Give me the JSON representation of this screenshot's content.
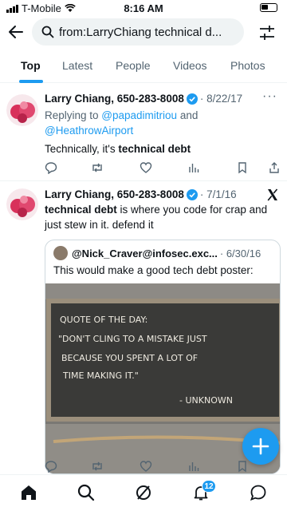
{
  "status": {
    "carrier": "T-Mobile",
    "time": "8:16 AM"
  },
  "search": {
    "query": "from:LarryChiang technical d..."
  },
  "tabs": [
    "Top",
    "Latest",
    "People",
    "Videos",
    "Photos"
  ],
  "active_tab": "Top",
  "tweets": [
    {
      "name": "Larry Chiang, 650-283-8008",
      "date": "· 8/22/17",
      "replying_prefix": "Replying to ",
      "mention1": "@papadimitriou",
      "and": " and",
      "mention2": "@HeathrowAirport",
      "text_pre": "Technically, it's ",
      "text_bold": "technical debt"
    },
    {
      "name": "Larry Chiang, 650-283-8008",
      "date": "· 7/1/16",
      "text_bold": "technical debt",
      "text_rest": " is where you code for crap and just stew in it. defend it",
      "quote": {
        "author": "@Nick_Craver@infosec.exc...",
        "date": "· 6/30/16",
        "text": "This would make a good tech debt poster:",
        "image_lines": [
          "QUOTE OF THE DAY:",
          "\"DON'T CLING TO A MISTAKE JUST",
          "BECAUSE YOU SPENT A LOT OF",
          "TIME MAKING IT.\"",
          "- UNKNOWN"
        ]
      }
    }
  ],
  "notifications_badge": "12",
  "colors": {
    "accent": "#1d9bf0",
    "text": "#0f1419",
    "muted": "#536471"
  }
}
